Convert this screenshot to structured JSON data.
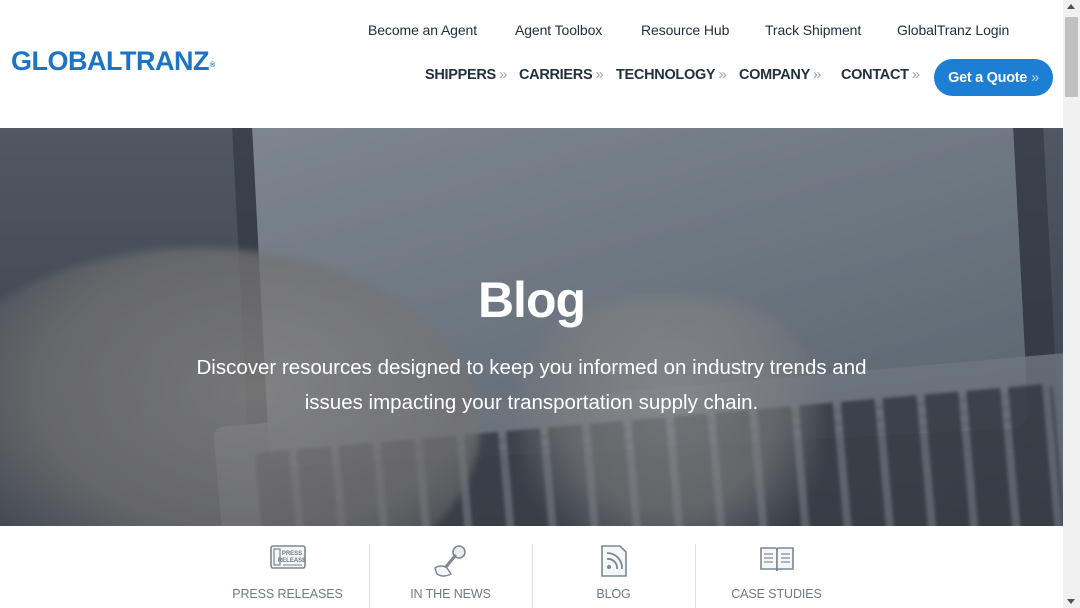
{
  "brand": {
    "logo_text": "GLOBALTRANZ",
    "logo_mark": "®",
    "color": "#1d74c4"
  },
  "top_nav": [
    {
      "label": "Become an Agent"
    },
    {
      "label": "Agent Toolbox"
    },
    {
      "label": "Resource Hub"
    },
    {
      "label": "Track Shipment"
    },
    {
      "label": "GlobalTranz Login"
    }
  ],
  "main_nav": [
    {
      "label": "SHIPPERS",
      "icon": "chevron-double-right-icon"
    },
    {
      "label": "CARRIERS",
      "icon": "chevron-double-right-icon"
    },
    {
      "label": "TECHNOLOGY",
      "icon": "chevron-double-right-icon"
    },
    {
      "label": "COMPANY",
      "icon": "chevron-double-right-icon"
    },
    {
      "label": "CONTACT",
      "icon": "chevron-double-right-icon"
    }
  ],
  "chevron_glyph": "»",
  "cta": {
    "label": "Get a Quote",
    "color": "#1d7fd4"
  },
  "hero": {
    "title": "Blog",
    "subtitle_line1": "Discover resources designed to keep you informed on industry trends and",
    "subtitle_line2": "issues impacting your transportation supply chain."
  },
  "categories": [
    {
      "label": "PRESS RELEASES",
      "icon": "press-release-icon",
      "icon_text_1": "PRESS",
      "icon_text_2": "RELEASE"
    },
    {
      "label": "IN THE NEWS",
      "icon": "microphone-icon"
    },
    {
      "label": "BLOG",
      "icon": "rss-document-icon"
    },
    {
      "label": "CASE STUDIES",
      "icon": "open-book-icon"
    }
  ]
}
